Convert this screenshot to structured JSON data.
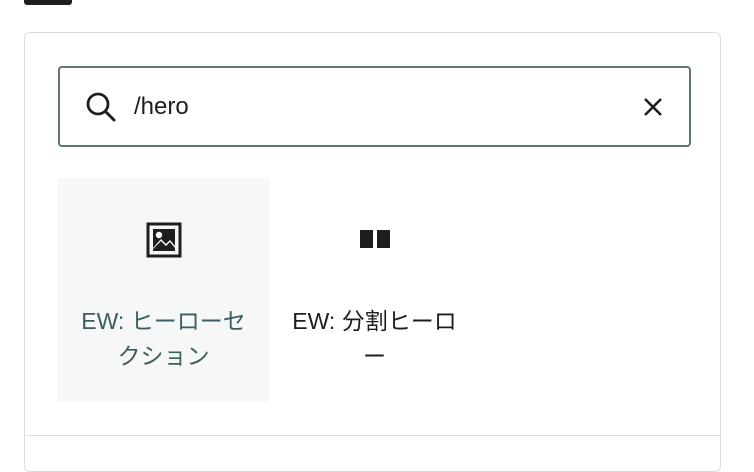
{
  "search": {
    "value": "/hero",
    "icon": "search-icon",
    "clear_icon": "close-icon"
  },
  "results": [
    {
      "label": "EW: ヒーローセクション",
      "icon": "image-icon",
      "active": true
    },
    {
      "label": "EW: 分割ヒーロー",
      "icon": "columns-icon",
      "active": false
    }
  ],
  "colors": {
    "search_border": "#5e767a",
    "active_bg": "#f6f7f7",
    "active_label": "#3c5d62",
    "text": "#1e1e1e"
  }
}
